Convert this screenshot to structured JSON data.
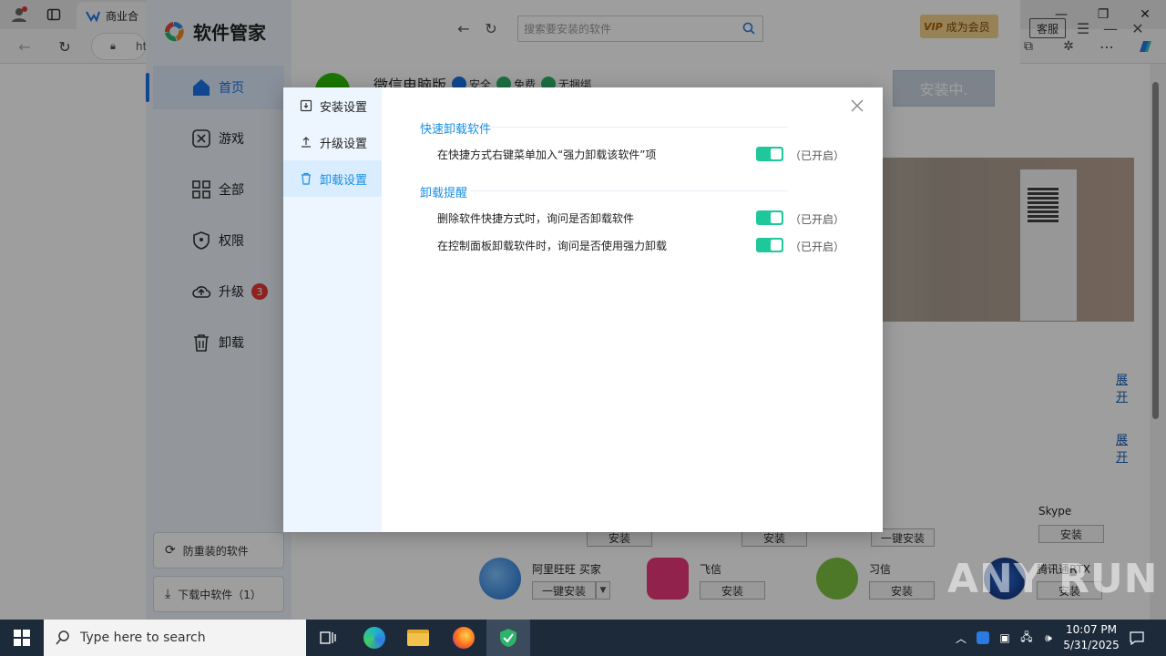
{
  "browser": {
    "tab_title": "商业合",
    "url_fragment": "ht"
  },
  "app": {
    "brand": "软件管家",
    "search_placeholder": "搜索要安装的软件",
    "vip_badge": "VIP",
    "vip_label": "成为会员",
    "support_label": "客服",
    "nav": [
      {
        "label": "首页",
        "icon": "home-icon"
      },
      {
        "label": "游戏",
        "icon": "game-icon"
      },
      {
        "label": "全部",
        "icon": "grid-icon"
      },
      {
        "label": "权限",
        "icon": "shield-icon"
      },
      {
        "label": "升级",
        "icon": "cloud-upload-icon",
        "badge": "3"
      },
      {
        "label": "卸载",
        "icon": "trash-icon"
      }
    ],
    "side_bottom": {
      "anti_reinstall": "防重装的软件",
      "downloading": "下载中软件（1）"
    },
    "featured": {
      "title": "微信电脑版",
      "chips": [
        "安全",
        "免费",
        "无捆绑"
      ],
      "install_button": "安装中."
    },
    "expand_label": "展开",
    "apps": [
      {
        "name": "Skype",
        "button": "安装"
      },
      {
        "name": "阿里旺旺 买家",
        "button": "一键安装"
      },
      {
        "name": "飞信",
        "button": "安装"
      },
      {
        "name": "习信",
        "button": "安装"
      },
      {
        "name": "腾讯通RTX",
        "button": "安装"
      }
    ],
    "row_buttons": [
      "安装",
      "安装",
      "一键安装"
    ]
  },
  "dialog": {
    "tabs": [
      "安装设置",
      "升级设置",
      "卸载设置"
    ],
    "active_tab": "卸载设置",
    "sections": [
      {
        "title": "快速卸载软件",
        "options": [
          {
            "text": "在快捷方式右键菜单加入“强力卸载该软件”项",
            "enabled": true,
            "state_text": "（已开启）"
          }
        ]
      },
      {
        "title": "卸载提醒",
        "options": [
          {
            "text": "删除软件快捷方式时，询问是否卸载软件",
            "enabled": true,
            "state_text": "（已开启）"
          },
          {
            "text": "在控制面板卸载软件时，询问是否使用强力卸载",
            "enabled": true,
            "state_text": "（已开启）"
          }
        ]
      }
    ]
  },
  "watermark": "ANY RUN",
  "taskbar": {
    "search_placeholder": "Type here to search",
    "time": "10:07 PM",
    "date": "5/31/2025"
  },
  "colors": {
    "accent": "#1a8fe0",
    "toggle_on": "#1fc89a",
    "badge": "#e53935",
    "taskbar": "#1c2a3a"
  }
}
